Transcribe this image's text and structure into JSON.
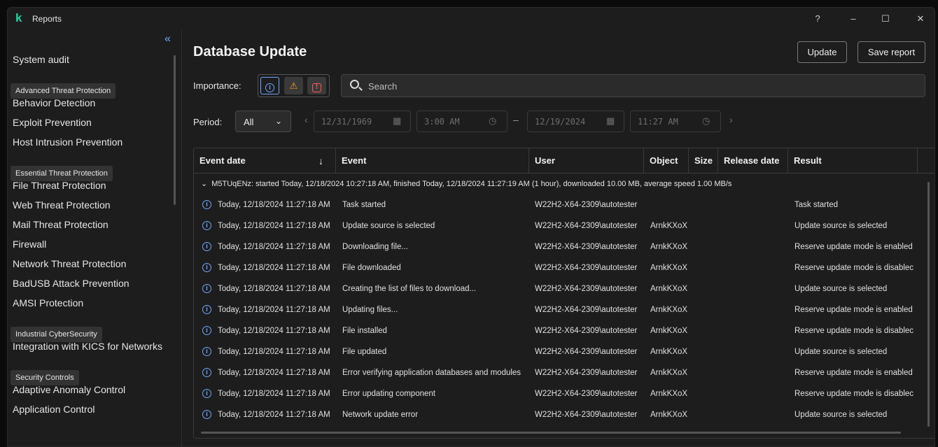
{
  "app": {
    "title": "Reports",
    "logo_letter": "k"
  },
  "window_controls": {
    "help": "?",
    "minimize": "–",
    "maximize": "☐",
    "close": "✕"
  },
  "sidebar": {
    "collapse_glyph": "«",
    "items": [
      {
        "type": "item",
        "label": "System audit"
      },
      {
        "type": "group",
        "label": "Advanced Threat Protection"
      },
      {
        "type": "item",
        "label": "Behavior Detection"
      },
      {
        "type": "item",
        "label": "Exploit Prevention"
      },
      {
        "type": "item",
        "label": "Host Intrusion Prevention"
      },
      {
        "type": "group",
        "label": "Essential Threat Protection"
      },
      {
        "type": "item",
        "label": "File Threat Protection"
      },
      {
        "type": "item",
        "label": "Web Threat Protection"
      },
      {
        "type": "item",
        "label": "Mail Threat Protection"
      },
      {
        "type": "item",
        "label": "Firewall"
      },
      {
        "type": "item",
        "label": "Network Threat Protection"
      },
      {
        "type": "item",
        "label": "BadUSB Attack Prevention"
      },
      {
        "type": "item",
        "label": "AMSI Protection"
      },
      {
        "type": "group",
        "label": "Industrial CyberSecurity"
      },
      {
        "type": "item",
        "label": "Integration with KICS for Networks"
      },
      {
        "type": "group",
        "label": "Security Controls"
      },
      {
        "type": "item",
        "label": "Adaptive Anomaly Control"
      },
      {
        "type": "item",
        "label": "Application Control"
      }
    ]
  },
  "header": {
    "title": "Database Update",
    "update_label": "Update",
    "save_report_label": "Save report"
  },
  "filters": {
    "importance_label": "Importance:",
    "importance_icons": {
      "info": "i",
      "warning": "⚠",
      "critical": "!"
    },
    "search_placeholder": "Search",
    "period_label": "Period:",
    "period_value": "All",
    "period_chevron": "⌄",
    "start_date": "12/31/1969",
    "start_time": "3:00 AM",
    "end_date": "12/19/2024",
    "end_time": "11:27 AM",
    "range_dash": "–",
    "prev_glyph": "‹",
    "next_glyph": "›",
    "calendar_glyph": "▦",
    "clock_glyph": "◷"
  },
  "table": {
    "columns": [
      "Event date",
      "Event",
      "User",
      "Object",
      "Size",
      "Release date",
      "Result"
    ],
    "sort_glyph": "↓",
    "group": {
      "chevron": "⌄",
      "text": "M5TUqENz: started Today, 12/18/2024 10:27:18 AM, finished Today, 12/18/2024 11:27:19 AM (1 hour), downloaded 10.00 MB, average speed 1.00 MB/s"
    },
    "rows": [
      {
        "date": "Today, 12/18/2024 11:27:18 AM",
        "event": "Task started",
        "user": "W22H2-X64-2309\\autotester",
        "object": "",
        "size": "",
        "release": "",
        "result": "Task started"
      },
      {
        "date": "Today, 12/18/2024 11:27:18 AM",
        "event": "Update source is selected",
        "user": "W22H2-X64-2309\\autotester",
        "object": "ArnkKXoX",
        "size": "",
        "release": "",
        "result": "Update source is selected"
      },
      {
        "date": "Today, 12/18/2024 11:27:18 AM",
        "event": "Downloading file...",
        "user": "W22H2-X64-2309\\autotester",
        "object": "ArnkKXoX",
        "size": "",
        "release": "",
        "result": "Reserve update mode is enabled"
      },
      {
        "date": "Today, 12/18/2024 11:27:18 AM",
        "event": "File downloaded",
        "user": "W22H2-X64-2309\\autotester",
        "object": "ArnkKXoX",
        "size": "",
        "release": "",
        "result": "Reserve update mode is disablec"
      },
      {
        "date": "Today, 12/18/2024 11:27:18 AM",
        "event": "Creating the list of files to download...",
        "user": "W22H2-X64-2309\\autotester",
        "object": "ArnkKXoX",
        "size": "",
        "release": "",
        "result": "Update source is selected"
      },
      {
        "date": "Today, 12/18/2024 11:27:18 AM",
        "event": "Updating files...",
        "user": "W22H2-X64-2309\\autotester",
        "object": "ArnkKXoX",
        "size": "",
        "release": "",
        "result": "Reserve update mode is enabled"
      },
      {
        "date": "Today, 12/18/2024 11:27:18 AM",
        "event": "File installed",
        "user": "W22H2-X64-2309\\autotester",
        "object": "ArnkKXoX",
        "size": "",
        "release": "",
        "result": "Reserve update mode is disablec"
      },
      {
        "date": "Today, 12/18/2024 11:27:18 AM",
        "event": "File updated",
        "user": "W22H2-X64-2309\\autotester",
        "object": "ArnkKXoX",
        "size": "",
        "release": "",
        "result": "Update source is selected"
      },
      {
        "date": "Today, 12/18/2024 11:27:18 AM",
        "event": "Error verifying application databases and modules",
        "user": "W22H2-X64-2309\\autotester",
        "object": "ArnkKXoX",
        "size": "",
        "release": "",
        "result": "Reserve update mode is enabled"
      },
      {
        "date": "Today, 12/18/2024 11:27:18 AM",
        "event": "Error updating component",
        "user": "W22H2-X64-2309\\autotester",
        "object": "ArnkKXoX",
        "size": "",
        "release": "",
        "result": "Reserve update mode is disablec"
      },
      {
        "date": "Today, 12/18/2024 11:27:18 AM",
        "event": "Network update error",
        "user": "W22H2-X64-2309\\autotester",
        "object": "ArnkKXoX",
        "size": "",
        "release": "",
        "result": "Update source is selected"
      }
    ]
  },
  "colors": {
    "accent_blue": "#6fa8ff",
    "warning_orange": "#f5a623",
    "critical_red": "#ff5a5a",
    "brand_green": "#1fd6a0"
  }
}
